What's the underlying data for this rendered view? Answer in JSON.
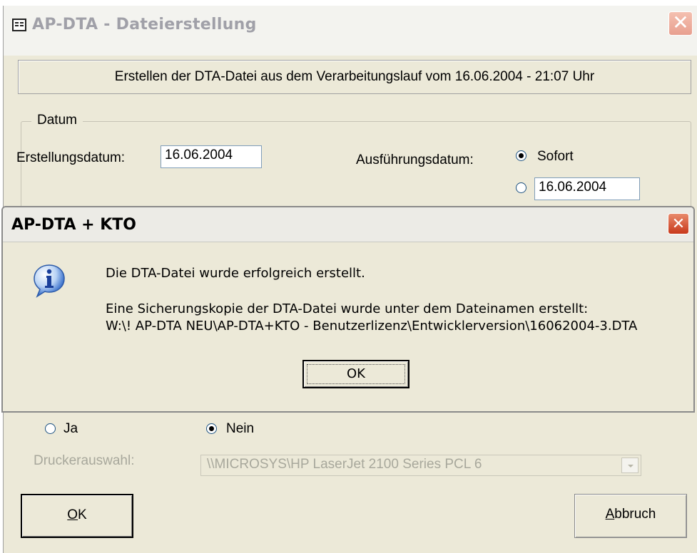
{
  "main_window": {
    "title": "AP-DTA - Dateierstellung",
    "header_text": "Erstellen der DTA-Datei aus dem Verarbeitungslauf vom 16.06.2004 - 21:07 Uhr",
    "date_group": {
      "legend": "Datum",
      "creation_label": "Erstellungsdatum:",
      "creation_value": "16.06.2004",
      "execution_label": "Ausführungsdatum:",
      "option_immediate": "Sofort",
      "option_date_value": "16.06.2004",
      "selected": "Sofort"
    },
    "print_options": {
      "yes": "Ja",
      "no": "Nein",
      "selected": "Nein",
      "printer_label": "Druckerauswahl:",
      "printer_value": "\\\\MICROSYS\\HP LaserJet 2100 Series PCL 6"
    },
    "ok_button": {
      "mnemonic": "O",
      "rest": "K"
    },
    "cancel_button": {
      "mnemonic": "A",
      "rest": "bbruch"
    }
  },
  "message_dialog": {
    "title": "AP-DTA + KTO",
    "icon": "info-icon",
    "line1": "Die DTA-Datei wurde erfolgreich erstellt.",
    "line2": "Eine Sicherungskopie der DTA-Datei wurde unter dem Dateinamen erstellt:",
    "line3": "W:\\! AP-DTA NEU\\AP-DTA+KTO - Benutzerlizenz\\Entwicklerversion\\16062004-3.DTA",
    "ok_label": "OK"
  },
  "colors": {
    "dialog_face": "#ece9d8",
    "close_red": "#c8391b",
    "info_blue": "#2c66c8"
  }
}
